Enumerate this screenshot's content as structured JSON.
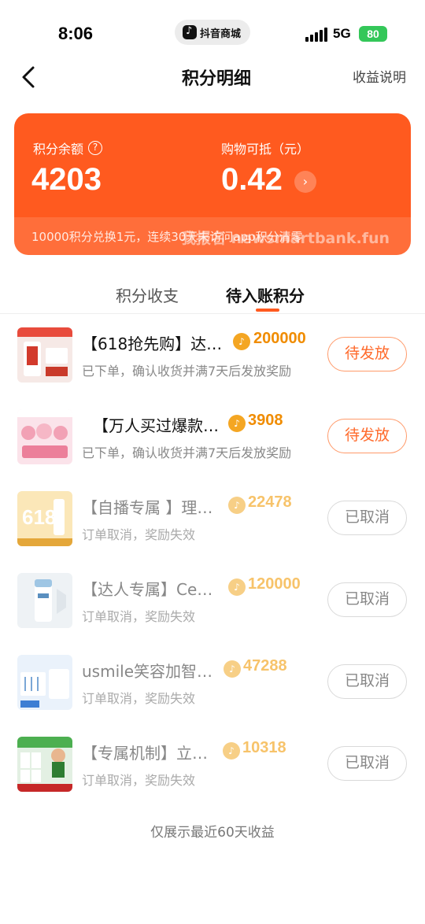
{
  "status_bar": {
    "time": "8:06",
    "app_name": "抖音商城",
    "network": "5G",
    "battery": "80"
  },
  "nav": {
    "title": "积分明细",
    "right_link": "收益说明"
  },
  "summary": {
    "balance_label": "积分余额",
    "balance_value": "4203",
    "deduct_label": "购物可抵（元）",
    "deduct_value": "0.42",
    "note": "10000积分兑换1元，连续30天未访问app积分清零",
    "watermark": "我报名 newsmartbank.fun"
  },
  "tabs": [
    {
      "label": "积分收支",
      "active": false
    },
    {
      "label": "待入账积分",
      "active": true
    }
  ],
  "colors": {
    "accent": "#ff5a1f",
    "points": "#f08c00"
  },
  "items": [
    {
      "title": "【618抢先购】达…",
      "points": "200000",
      "desc": "已下单，确认收货并满7天后发放奖励",
      "status": "待发放",
      "thumb_icon": "product-image"
    },
    {
      "title": "【万人买过爆款…",
      "points": "3908",
      "desc": "已下单，确认收货并满7天后发放奖励",
      "status": "待发放",
      "thumb_icon": "product-image"
    },
    {
      "title": "【自播专属 】理…",
      "points": "22478",
      "desc": "订单取消，奖励失效",
      "status": "已取消",
      "thumb_icon": "product-image"
    },
    {
      "title": "【达人专属】Ce…",
      "points": "120000",
      "desc": "订单取消，奖励失效",
      "status": "已取消",
      "thumb_icon": "product-image"
    },
    {
      "title": "usmile笑容加智…",
      "points": "47288",
      "desc": "订单取消，奖励失效",
      "status": "已取消",
      "thumb_icon": "product-image"
    },
    {
      "title": "【专属机制】立…",
      "points": "10318",
      "desc": "订单取消，奖励失效",
      "status": "已取消",
      "thumb_icon": "product-image"
    }
  ],
  "footer_note": "仅展示最近60天收益"
}
